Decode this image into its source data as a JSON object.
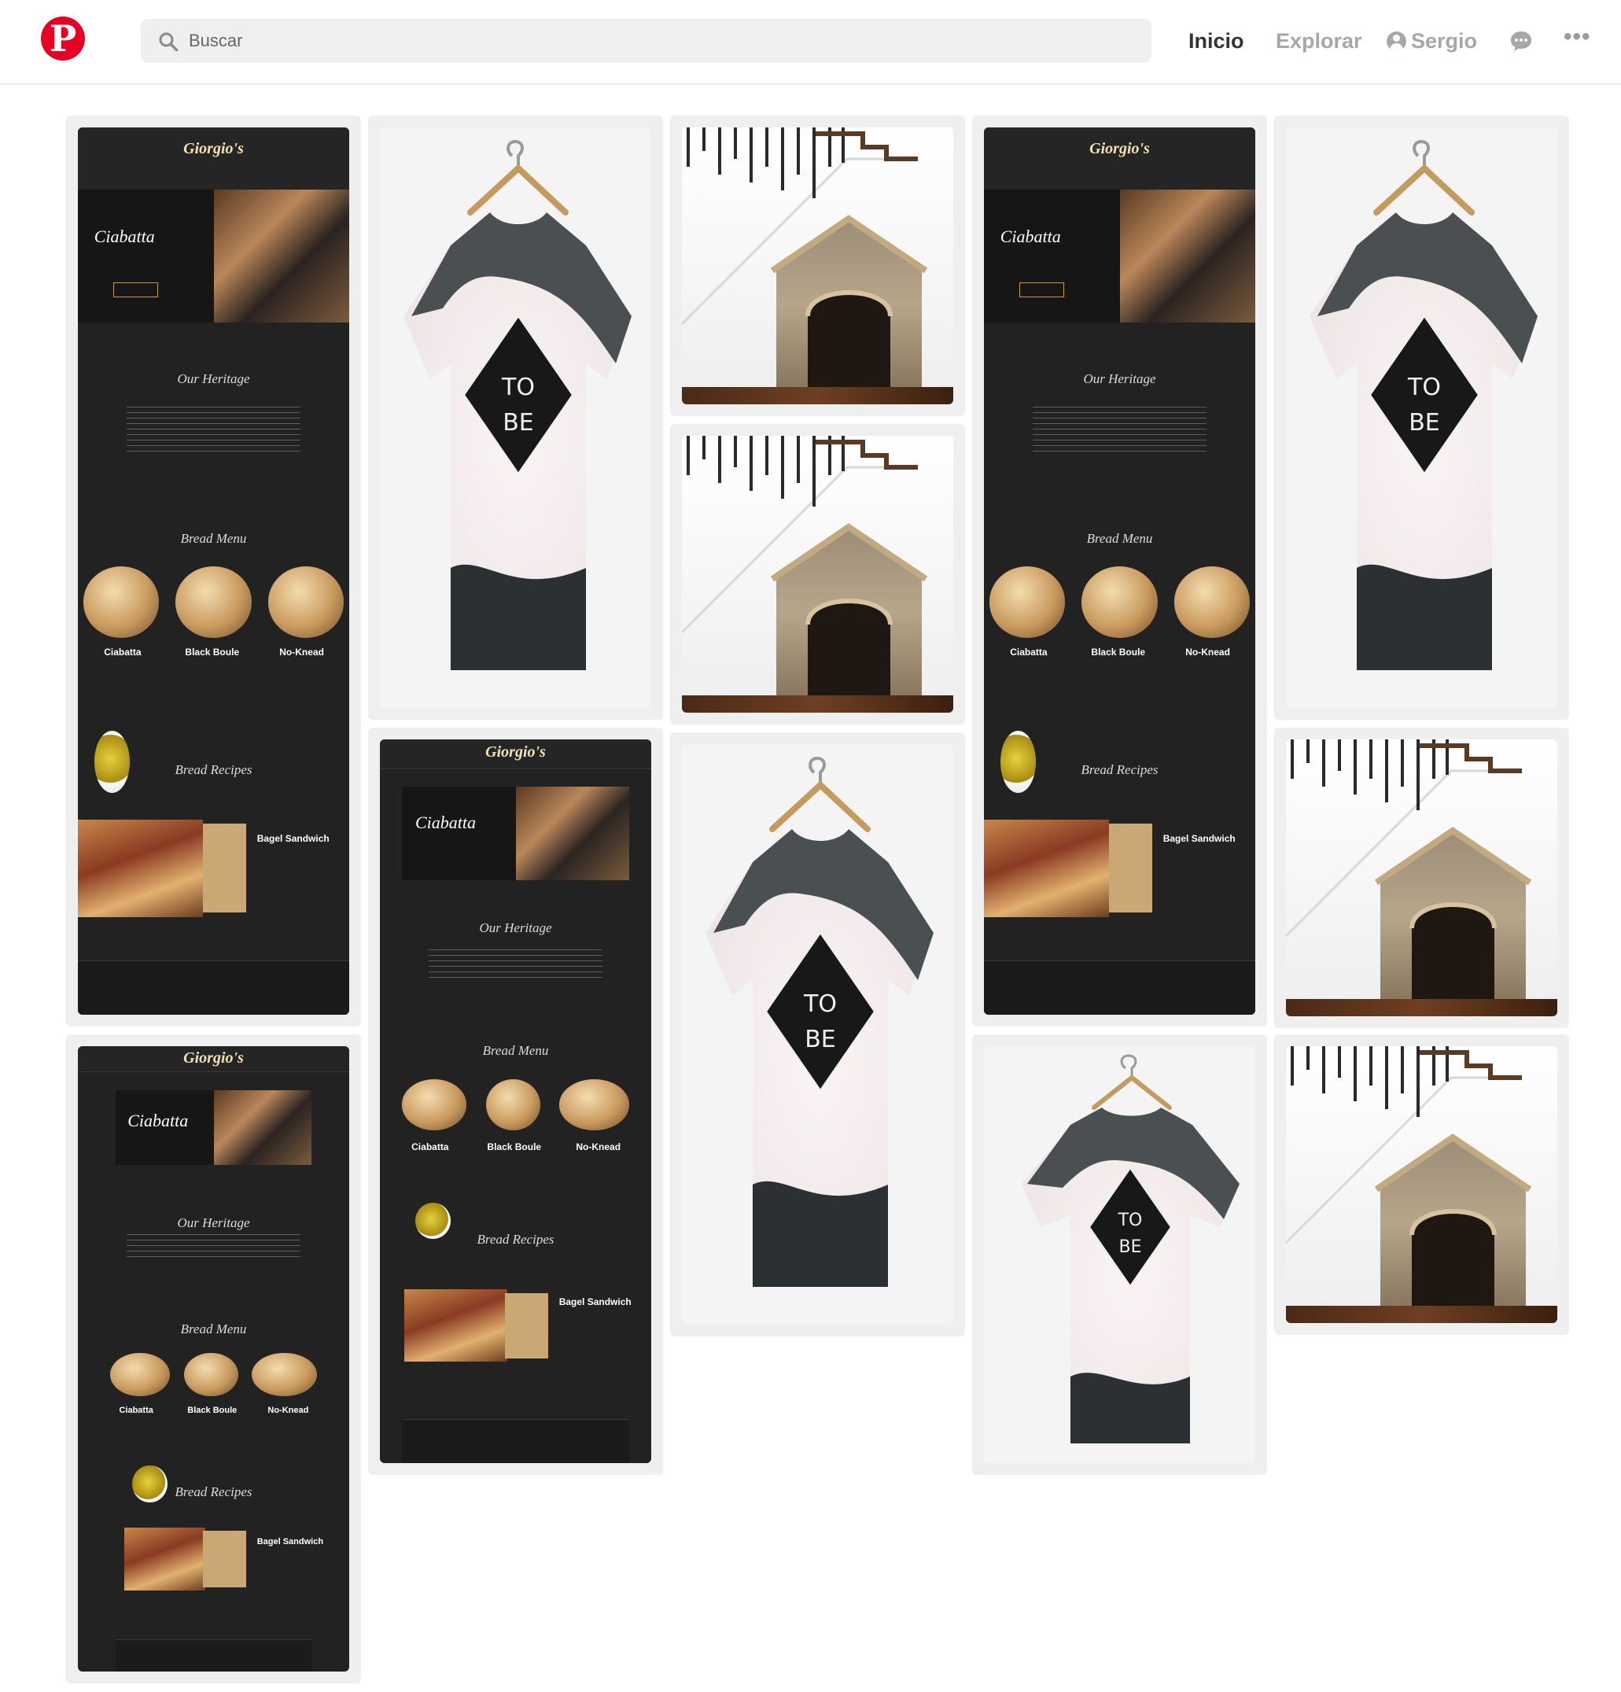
{
  "header": {
    "logo_letter": "P",
    "search": {
      "placeholder": "Buscar"
    },
    "nav": [
      {
        "label": "Inicio",
        "active": true
      },
      {
        "label": "Explorar",
        "active": false
      },
      {
        "label": "Sergio",
        "active": false
      }
    ],
    "icons": [
      "pinterest-logo",
      "search-icon",
      "user-icon",
      "chat-icon",
      "more-icon"
    ]
  },
  "colors": {
    "brand": "#e60023",
    "card_bg": "#efefef",
    "text_active": "#333333",
    "text_muted": "#a7a7a7"
  },
  "bakery_mockup": {
    "logo": "Giorgio's",
    "hero_title": "Ciabatta",
    "sections": [
      "Our Heritage",
      "Bread Menu",
      "Bread Recipes"
    ],
    "breads": [
      "Ciabatta",
      "Black Boule",
      "No-Knead"
    ],
    "recipe_title": "Bagel Sandwich"
  },
  "tshirt": {
    "print": [
      "TO",
      "BE"
    ]
  },
  "pins": [
    {
      "type": "bakery"
    },
    {
      "type": "tshirt"
    },
    {
      "type": "doghouse"
    },
    {
      "type": "bakery"
    },
    {
      "type": "tshirt"
    },
    {
      "type": "bakery"
    },
    {
      "type": "doghouse"
    },
    {
      "type": "doghouse"
    },
    {
      "type": "bakery"
    },
    {
      "type": "tshirt"
    },
    {
      "type": "tshirt"
    },
    {
      "type": "doghouse"
    }
  ]
}
